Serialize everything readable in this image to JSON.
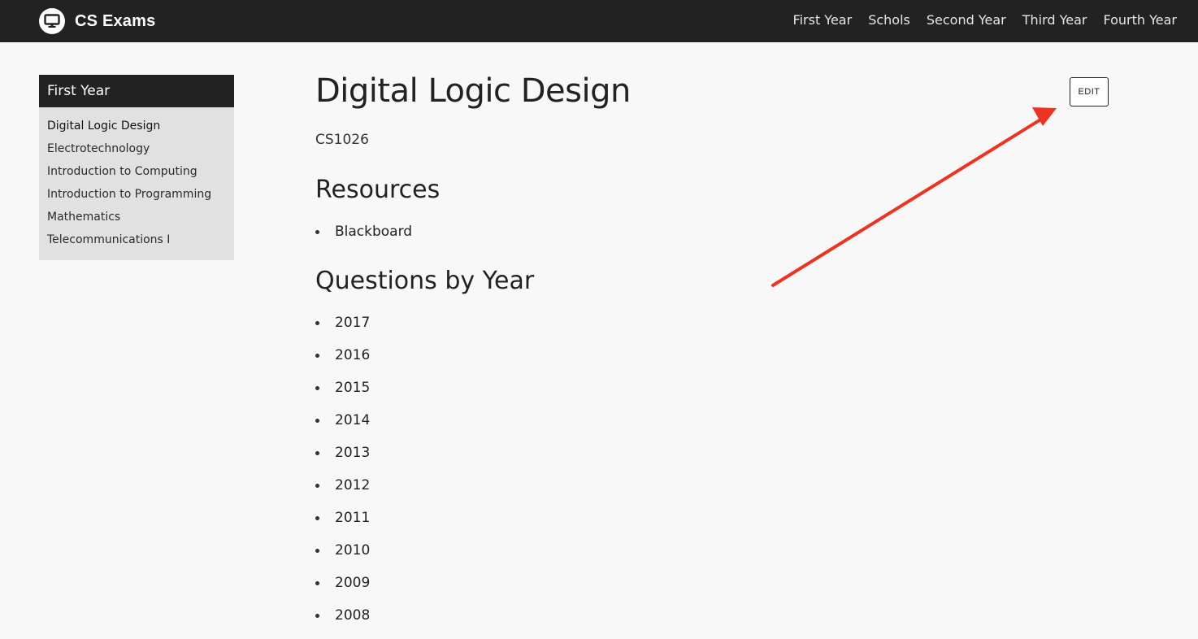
{
  "header": {
    "brand_name": "CS Exams",
    "nav": [
      "First Year",
      "Schols",
      "Second Year",
      "Third Year",
      "Fourth Year"
    ]
  },
  "sidebar": {
    "title": "First Year",
    "items": [
      "Digital Logic Design",
      "Electrotechnology",
      "Introduction to Computing",
      "Introduction to Programming",
      "Mathematics",
      "Telecommunications I"
    ]
  },
  "main": {
    "title": "Digital Logic Design",
    "course_code": "CS1026",
    "edit_label": "EDIT",
    "resources_heading": "Resources",
    "resources": [
      "Blackboard"
    ],
    "questions_heading": "Questions by Year",
    "years": [
      "2017",
      "2016",
      "2015",
      "2014",
      "2013",
      "2012",
      "2011",
      "2010",
      "2009",
      "2008"
    ]
  },
  "icons": {
    "brand": "monitor-icon",
    "annotation": "red-arrow"
  },
  "colors": {
    "header_bg": "#222222",
    "page_bg": "#f8f8f8",
    "sidebar_bg": "#e1e1e1",
    "annotation_arrow": "#ee3322"
  }
}
